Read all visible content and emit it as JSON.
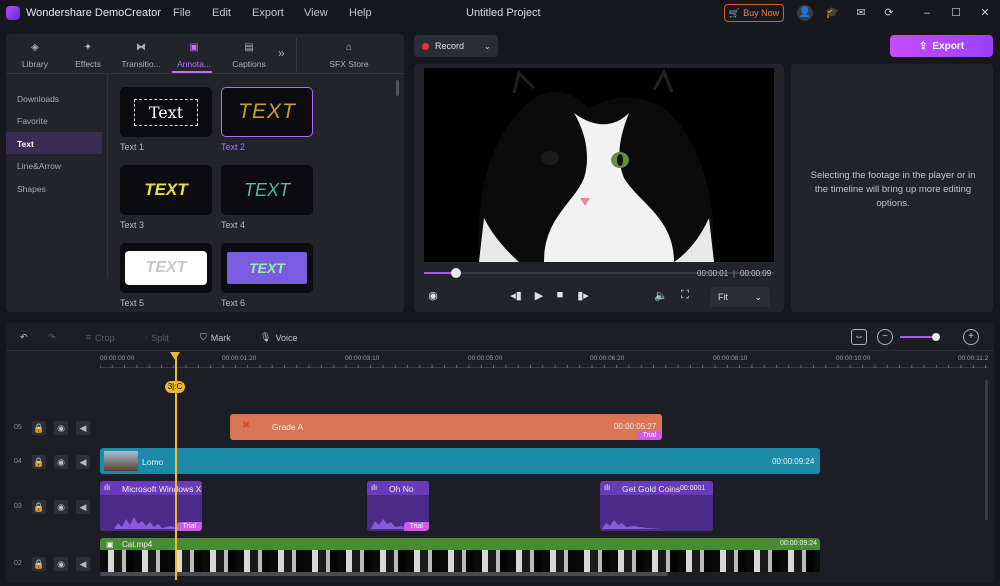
{
  "app": {
    "title": "Wondershare DemoCreator",
    "menu": [
      "File",
      "Edit",
      "Export",
      "View",
      "Help"
    ],
    "project_title": "Untitled Project",
    "buy_label": "Buy Now"
  },
  "media_panel": {
    "tabs": [
      {
        "label": "Library",
        "icon": "library-icon"
      },
      {
        "label": "Effects",
        "icon": "effects-icon"
      },
      {
        "label": "Transitio...",
        "icon": "transition-icon"
      },
      {
        "label": "Annota...",
        "icon": "annotation-icon"
      },
      {
        "label": "Captions",
        "icon": "captions-icon"
      },
      {
        "label": "SFX Store",
        "icon": "store-icon"
      }
    ],
    "more_glyph": "»",
    "categories": [
      "Downloads",
      "Favorite",
      "Text",
      "Line&Arrow",
      "Shapes"
    ],
    "active_category": "Text",
    "items": [
      {
        "label": "Text 1",
        "preview": "Text"
      },
      {
        "label": "Text 2",
        "preview": "TEXT"
      },
      {
        "label": "Text 3",
        "preview": "TEXT"
      },
      {
        "label": "Text 4",
        "preview": "TEXT"
      },
      {
        "label": "Text 5",
        "preview": "TEXT"
      },
      {
        "label": "Text 6",
        "preview": "TEXT"
      }
    ]
  },
  "preview": {
    "record_label": "Record",
    "current_time": "00:00:01",
    "total_time": "00:00:09",
    "progress": 0.11,
    "fit_label": "Fit"
  },
  "export_label": "Export",
  "properties_message": "Selecting the footage in the player or in the timeline will bring up more editing options.",
  "timeline": {
    "tools": [
      "Crop",
      "Split",
      "Mark",
      "Voice"
    ],
    "ruler_ticks": [
      "00:00:00:00",
      "00:00:01:20",
      "00:00:03:10",
      "00:00:05:00",
      "00:00:06:20",
      "00:00:08:10",
      "00:00:10:00",
      "00:00:11:2"
    ],
    "playhead_badge": "3|:C",
    "zoom_level": 0.9,
    "tracks": [
      {
        "num": "05",
        "clips": [
          {
            "title": "Grade A",
            "time": "00:00:05:27",
            "trial": "Trial"
          }
        ]
      },
      {
        "num": "04",
        "clips": [
          {
            "title": "Lomo",
            "time": "00:00:09:24"
          }
        ]
      },
      {
        "num": "03",
        "clips": [
          {
            "title": "Microsoft Windows X",
            "trial": "Trial"
          },
          {
            "title": "Oh No",
            "trial": "Trial"
          },
          {
            "title": "Get Gold Coins",
            "time": "00:0001"
          }
        ]
      },
      {
        "num": "02",
        "clips": [
          {
            "title": "Cat.mp4",
            "time": "00:00:09:24"
          }
        ]
      }
    ]
  },
  "colors": {
    "accent": "#b36cff",
    "export_gradient": [
      "#c64cff",
      "#9a40ff"
    ],
    "playhead": "#f0b830",
    "clip_grade": "#d87555",
    "clip_lomo": "#1b8aa8",
    "clip_audio": "#6a3ab8",
    "clip_video": "#4a8a30"
  }
}
